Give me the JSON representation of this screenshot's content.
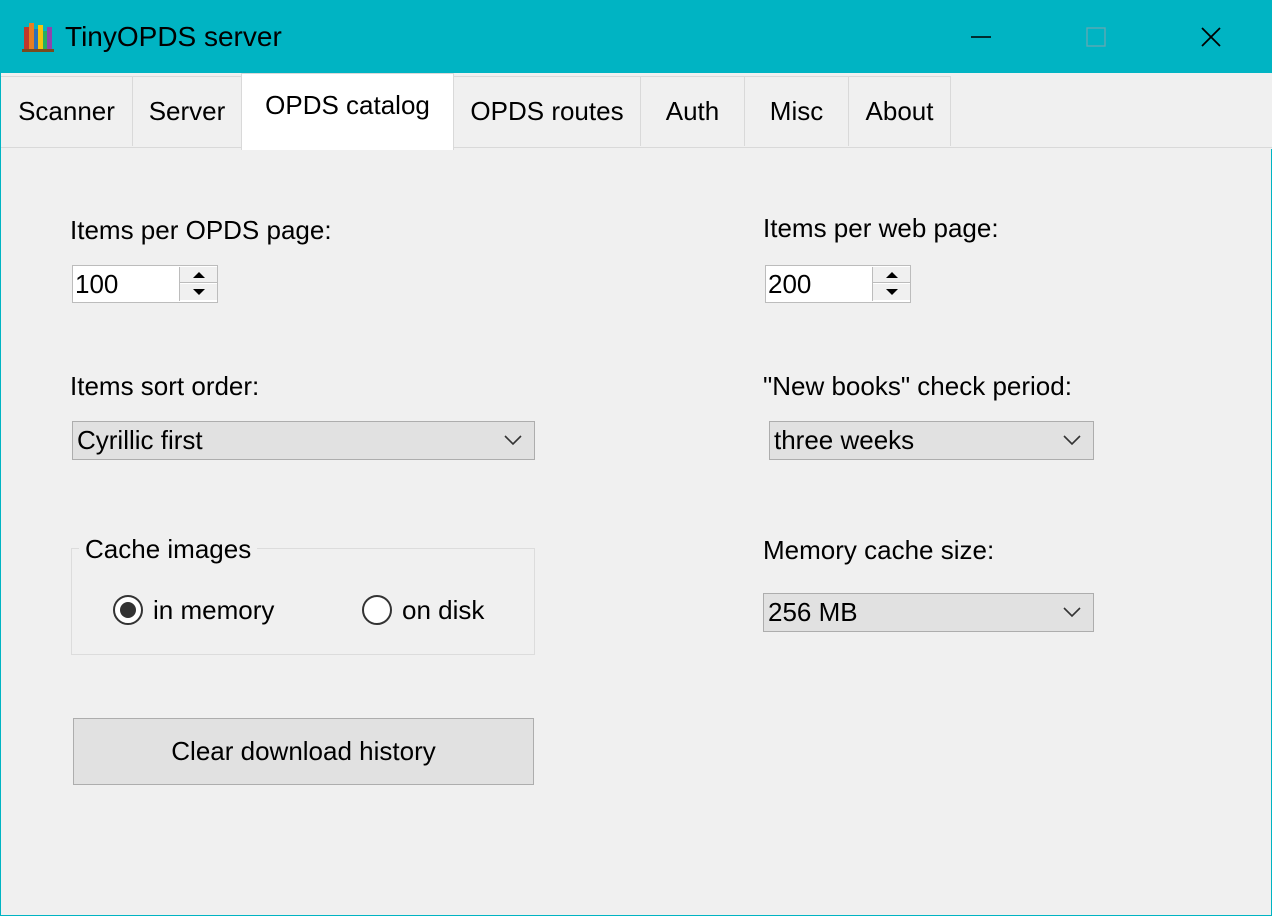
{
  "window": {
    "title": "TinyOPDS server",
    "accent_color": "#00b4c3"
  },
  "tabs": [
    {
      "label": "Scanner",
      "active": false
    },
    {
      "label": "Server",
      "active": false
    },
    {
      "label": "OPDS catalog",
      "active": true
    },
    {
      "label": "OPDS routes",
      "active": false
    },
    {
      "label": "Auth",
      "active": false
    },
    {
      "label": "Misc",
      "active": false
    },
    {
      "label": "About",
      "active": false
    }
  ],
  "opds_catalog": {
    "items_per_opds_page": {
      "label": "Items per OPDS page:",
      "value": "100"
    },
    "items_per_web_page": {
      "label": "Items per web page:",
      "value": "200"
    },
    "sort_order": {
      "label": "Items sort order:",
      "selected": "Cyrillic first"
    },
    "new_books_period": {
      "label": "\"New books\" check period:",
      "selected": "three weeks"
    },
    "cache_images": {
      "title": "Cache images",
      "options": [
        {
          "label": "in memory",
          "checked": true
        },
        {
          "label": "on disk",
          "checked": false
        }
      ]
    },
    "memory_cache_size": {
      "label": "Memory cache size:",
      "selected": "256 MB"
    },
    "clear_history_button": "Clear download history"
  },
  "icons": {
    "app": "bookshelf-icon",
    "minimize": "minimize-icon",
    "maximize": "maximize-icon",
    "close": "close-icon",
    "spin_up": "chevron-up-icon",
    "spin_down": "chevron-down-icon",
    "dropdown": "chevron-down-icon"
  }
}
